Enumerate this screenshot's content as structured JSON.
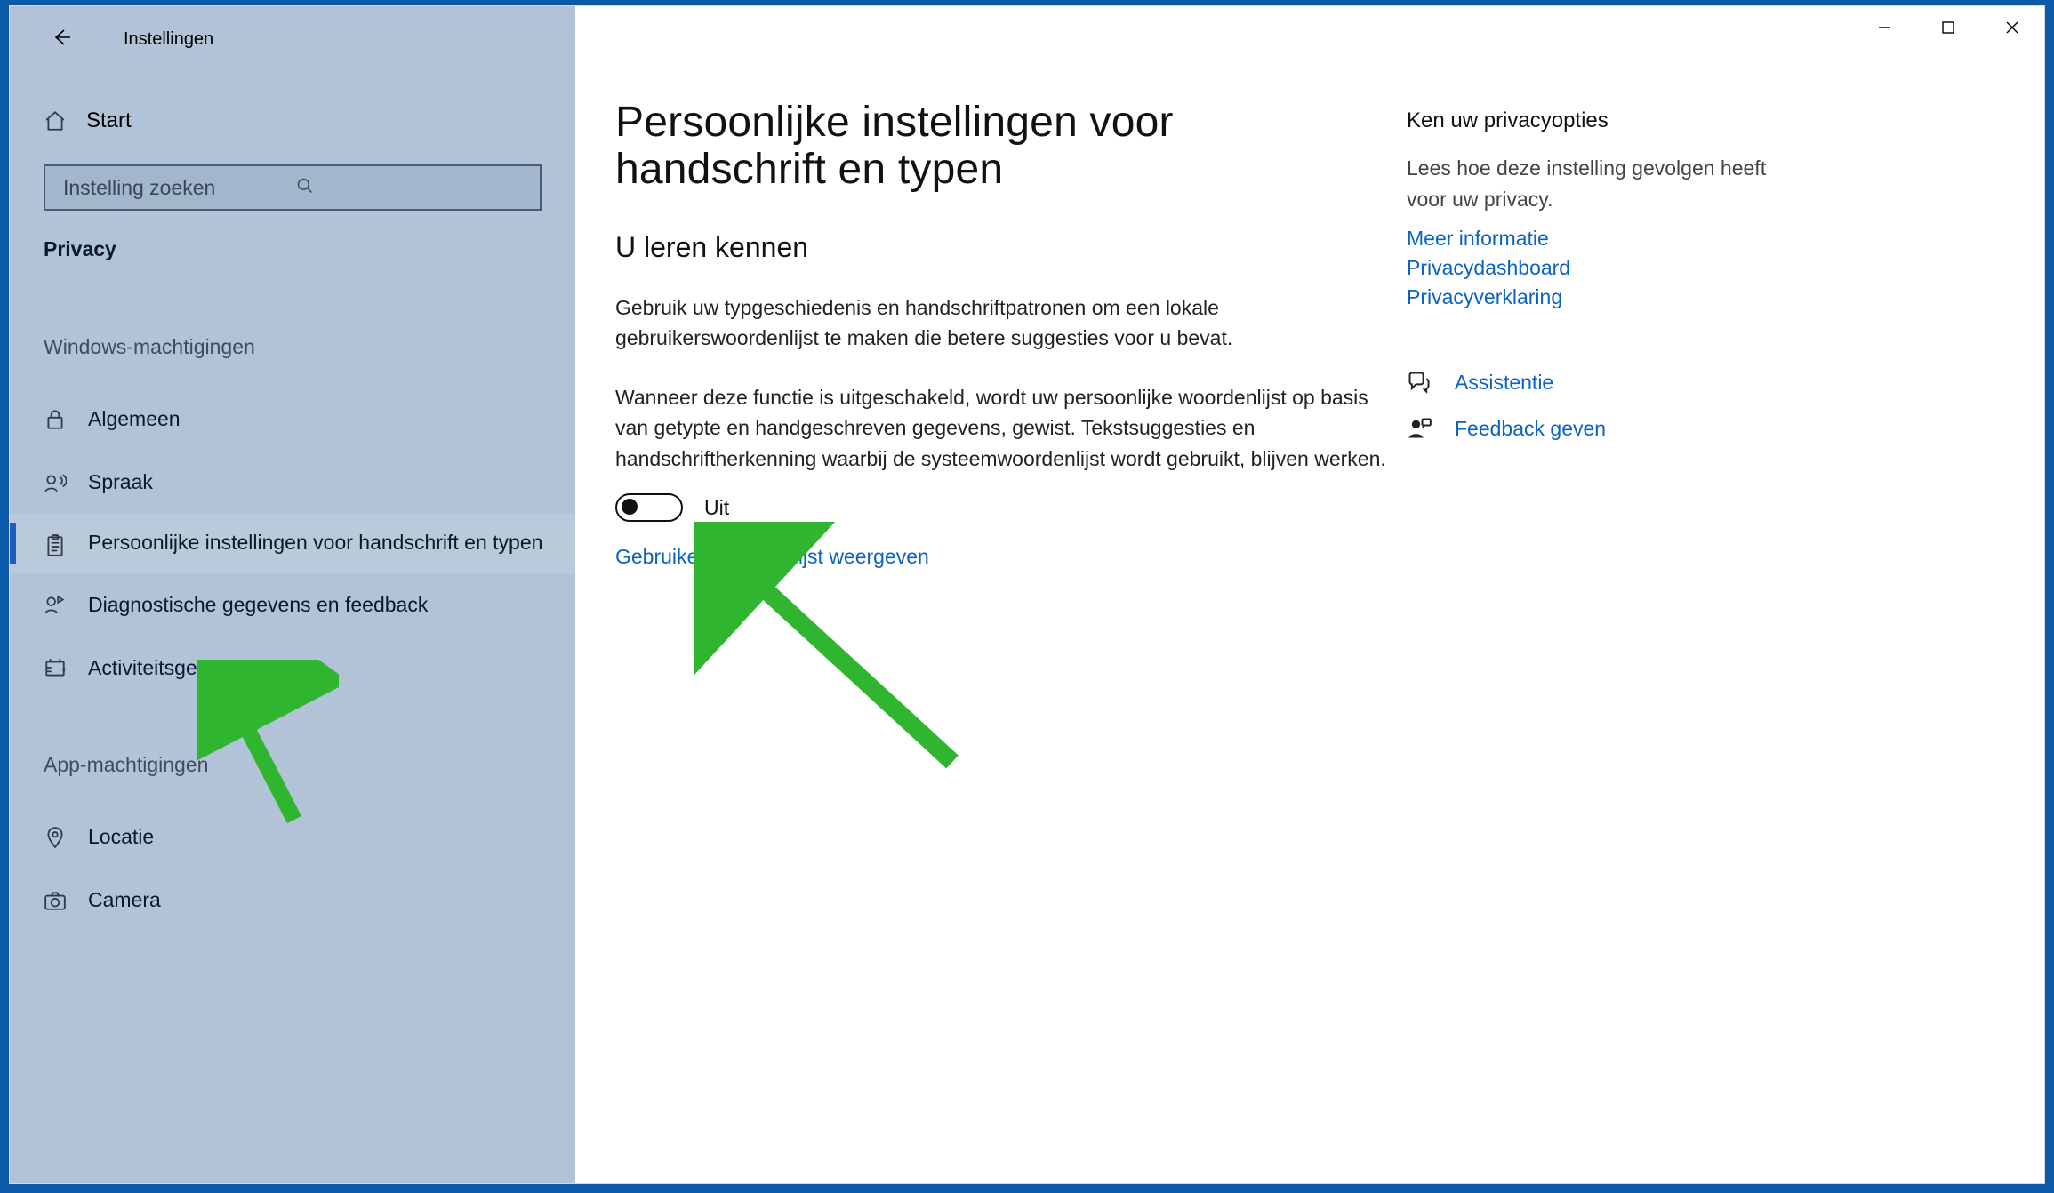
{
  "window": {
    "title": "Instellingen"
  },
  "sidebar": {
    "home": "Start",
    "search_placeholder": "Instelling zoeken",
    "current_category": "Privacy",
    "section1": "Windows-machtigingen",
    "section2": "App-machtigingen",
    "items": [
      {
        "label": "Algemeen"
      },
      {
        "label": "Spraak"
      },
      {
        "label": "Persoonlijke instellingen voor handschrift en typen"
      },
      {
        "label": "Diagnostische gegevens en feedback"
      },
      {
        "label": "Activiteitsgeschiedenis"
      }
    ],
    "app_items": [
      {
        "label": "Locatie"
      },
      {
        "label": "Camera"
      }
    ]
  },
  "content": {
    "title": "Persoonlijke instellingen voor handschrift en typen",
    "section_title": "U leren kennen",
    "para1": "Gebruik uw typgeschiedenis en handschriftpatronen om een lokale gebruikerswoordenlijst te maken die betere suggesties voor u bevat.",
    "para2": "Wanneer deze functie is uitgeschakeld, wordt uw persoonlijke woordenlijst op basis van getypte en handgeschreven gegevens, gewist. Tekstsuggesties en handschriftherkenning waarbij de systeemwoordenlijst wordt gebruikt, blijven werken.",
    "toggle_state": "Uit",
    "dictionary_link": "Gebruikerswoordenlijst weergeven"
  },
  "aside": {
    "title": "Ken uw privacyopties",
    "text": "Lees hoe deze instelling gevolgen heeft voor uw privacy.",
    "links": {
      "more_info": "Meer informatie",
      "dashboard": "Privacydashboard",
      "statement": "Privacyverklaring"
    },
    "help": {
      "assist": "Assistentie",
      "feedback": "Feedback geven"
    }
  }
}
